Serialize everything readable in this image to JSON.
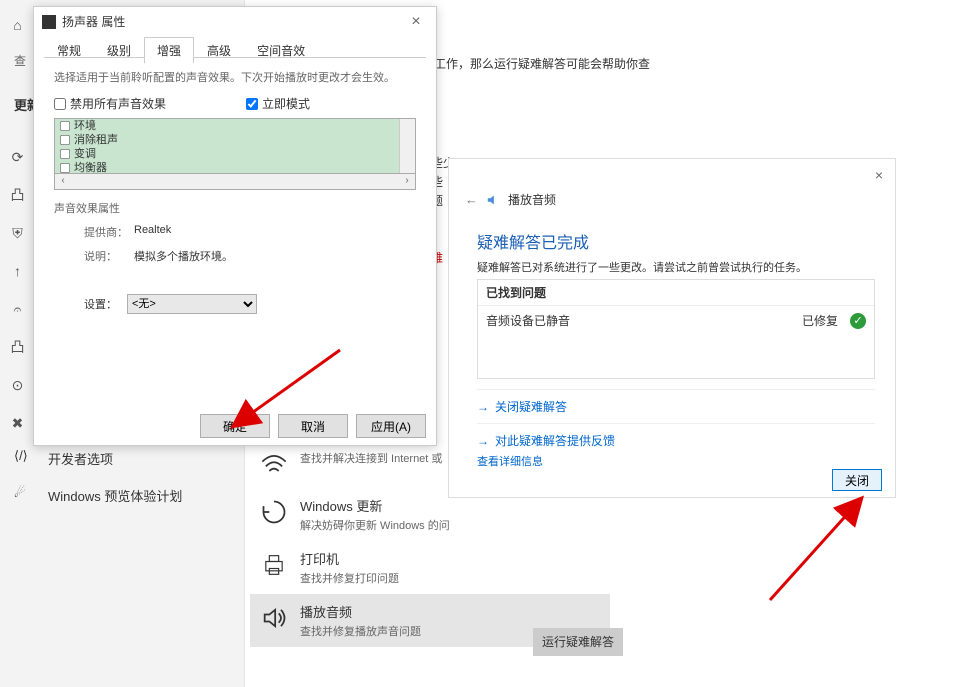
{
  "sidebar": {
    "search_partial": "查",
    "heading_partial": "更新和",
    "icon_rows": [
      "⌂",
      "",
      "⟳",
      "凸",
      "⊕",
      "↑",
      "🔑",
      "凸",
      "⊙",
      "✕",
      "⫽"
    ],
    "items": [
      {
        "label": "开发者选项"
      },
      {
        "label": "Windows 预览体验计划"
      }
    ]
  },
  "settings": {
    "intro": "正常工作，那么运行疑难解答可能会帮助你查",
    "right_lines": {
      "l1": "的某些少",
      "l2": "示这些",
      "l3": "目问题",
      "l4": "信息",
      "l5": "他疑难"
    },
    "trouble": [
      {
        "title": "",
        "desc": "查找并解决连接到 Internet 或"
      },
      {
        "title": "Windows 更新",
        "desc": "解决妨碍你更新 Windows 的问"
      },
      {
        "title": "打印机",
        "desc": "查找并修复打印问题"
      },
      {
        "title": "播放音频",
        "desc": "查找并修复播放声音问题"
      }
    ],
    "run_label": "运行疑难解答"
  },
  "props": {
    "title": "扬声器 属性",
    "tabs": [
      "常规",
      "级别",
      "增强",
      "高级",
      "空间音效"
    ],
    "active_tab": 2,
    "desc": "选择适用于当前聆听配置的声音效果。下次开始播放时更改才会生效。",
    "disable_label": "禁用所有声音效果",
    "instant_label": "立即模式",
    "effects": [
      "环境",
      "消除租声",
      "变调",
      "均衡器"
    ],
    "fieldset": "声音效果属性",
    "provider_k": "提供商：",
    "provider_v": "Realtek",
    "desc_k": "说明：",
    "desc_v": "模拟多个播放环境。",
    "settings_k": "设置：",
    "settings_sel": "<无>",
    "btn_ok": "确定",
    "btn_cancel": "取消",
    "btn_apply": "应用(A)"
  },
  "tshoot": {
    "head": "播放音频",
    "title": "疑难解答已完成",
    "sub": "疑难解答已对系统进行了一些更改。请尝试之前曾尝试执行的任务。",
    "found_head": "已找到问题",
    "found_item": "音频设备已静音",
    "found_status": "已修复",
    "link1": "关闭疑难解答",
    "link2": "对此疑难解答提供反馈",
    "detail": "查看详细信息",
    "close": "关闭"
  }
}
